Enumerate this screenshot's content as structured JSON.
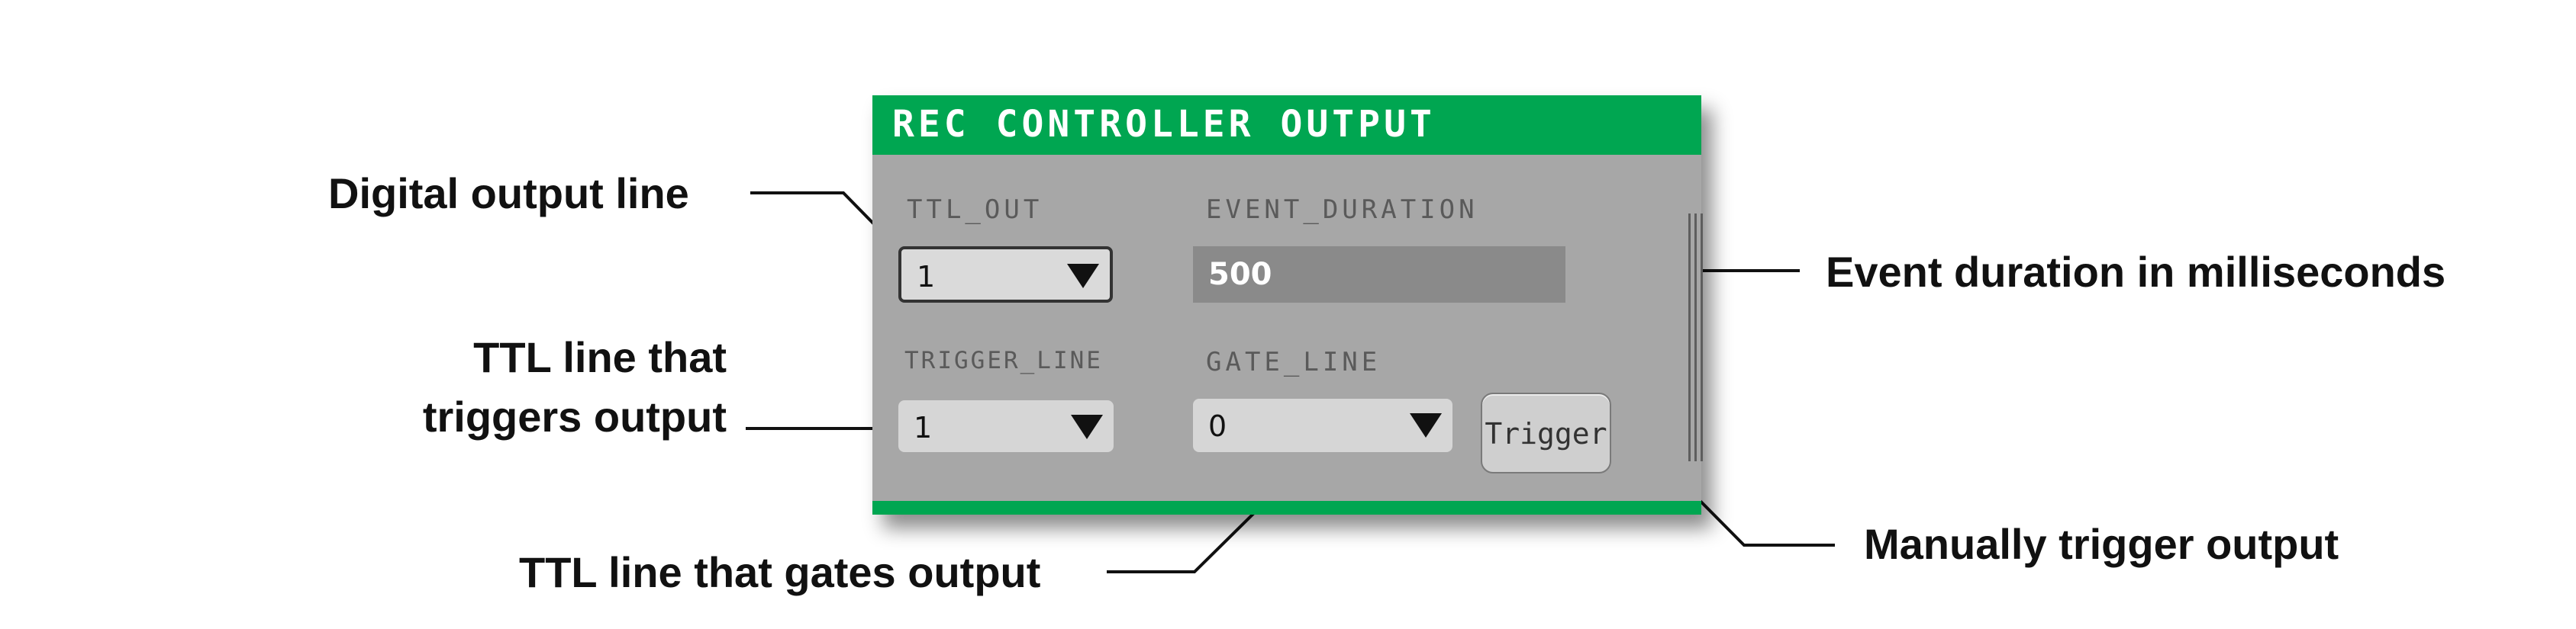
{
  "panel": {
    "title": "REC CONTROLLER OUTPUT",
    "header_color": "#00a651",
    "ttl_out": {
      "label": "TTL_OUT",
      "value": "1"
    },
    "event_duration": {
      "label": "EVENT_DURATION",
      "value": "500"
    },
    "trigger_line": {
      "label": "TRIGGER_LINE",
      "value": "1"
    },
    "gate_line": {
      "label": "GATE_LINE",
      "value": "0"
    },
    "trigger_button": {
      "label": "Trigger"
    }
  },
  "callouts": {
    "digital_output": "Digital output line",
    "trigger_line_1": "TTL line that",
    "trigger_line_2": "triggers output",
    "gate_line": "TTL line that gates output",
    "event_duration": "Event duration in milliseconds",
    "manual_trigger": "Manually trigger output"
  },
  "icons": {
    "dropdown_arrow": "chevron-down-icon"
  }
}
